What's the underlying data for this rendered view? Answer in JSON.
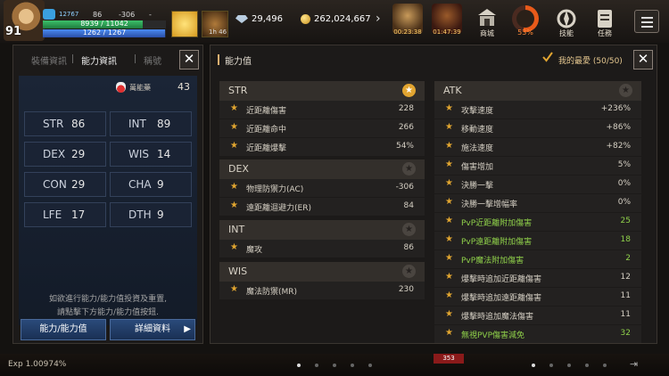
{
  "hud": {
    "level": "91",
    "stat1": "12767",
    "stat2": "86",
    "stat3": "-306",
    "stat4": "-",
    "hp_text": "8939 / 11042",
    "hp_fraction": 0.81,
    "mp_text": "1262 / 1267",
    "mp_fraction": 0.996,
    "buff2_text": "1h 46",
    "diamond": "29,496",
    "gold": "262,024,667",
    "event1_label": "00:23:38",
    "event2_label": "01:47:39",
    "shop_label": "商城",
    "ring_label": "53%",
    "ring_fraction": 0.53,
    "skill_label": "技能",
    "quest_label": "任務"
  },
  "left": {
    "tabs": [
      "裝備資訊",
      "能力資訊",
      "稱號"
    ],
    "potion_label": "萬能藥",
    "potion_value": "43",
    "stats": [
      {
        "key": "STR",
        "val": "86"
      },
      {
        "key": "INT",
        "val": "89"
      },
      {
        "key": "DEX",
        "val": "29"
      },
      {
        "key": "WIS",
        "val": "14"
      },
      {
        "key": "CON",
        "val": "29"
      },
      {
        "key": "CHA",
        "val": "9"
      },
      {
        "key": "LFE",
        "val": "17"
      },
      {
        "key": "DTH",
        "val": "9"
      }
    ],
    "hint_line1": "如欲進行能力/能力值投資及重置,",
    "hint_line2": "請點擊下方能力/能力值按鈕.",
    "btn_ability": "能力/能力值",
    "btn_detail": "詳細資料"
  },
  "right": {
    "title": "能力值",
    "fav_label": "我的最愛 (50/50)",
    "sections": {
      "str": {
        "name": "STR",
        "rows": [
          {
            "name": "近距離傷害",
            "val": "228"
          },
          {
            "name": "近距離命中",
            "val": "266"
          },
          {
            "name": "近距離爆擊",
            "val": "54%"
          }
        ]
      },
      "dex": {
        "name": "DEX",
        "rows": [
          {
            "name": "物理防禦力(AC)",
            "val": "-306"
          },
          {
            "name": "遠距離迴避力(ER)",
            "val": "84"
          }
        ]
      },
      "int": {
        "name": "INT",
        "rows": [
          {
            "name": "魔攻",
            "val": "86"
          }
        ]
      },
      "wis": {
        "name": "WIS",
        "rows": [
          {
            "name": "魔法防禦(MR)",
            "val": "230"
          }
        ]
      },
      "atk": {
        "name": "ATK",
        "rows": [
          {
            "name": "攻擊速度",
            "val": "+236%"
          },
          {
            "name": "移動速度",
            "val": "+86%"
          },
          {
            "name": "施法速度",
            "val": "+82%"
          },
          {
            "name": "傷害增加",
            "val": "5%"
          },
          {
            "name": "決勝一擊",
            "val": "0%"
          },
          {
            "name": "決勝一擊增幅率",
            "val": "0%"
          },
          {
            "name": "PvP近距離附加傷害",
            "val": "25"
          },
          {
            "name": "PvP遠距離附加傷害",
            "val": "18"
          },
          {
            "name": "PvP魔法附加傷害",
            "val": "2"
          },
          {
            "name": "爆擊時追加近距離傷害",
            "val": "12"
          },
          {
            "name": "爆擊時追加遠距離傷害",
            "val": "11"
          },
          {
            "name": "爆擊時追加魔法傷害",
            "val": "11"
          },
          {
            "name": "無視PVP傷害減免",
            "val": "32"
          }
        ]
      }
    }
  },
  "bottom": {
    "exp": "Exp 1.00974%",
    "chat_badge": "353"
  }
}
